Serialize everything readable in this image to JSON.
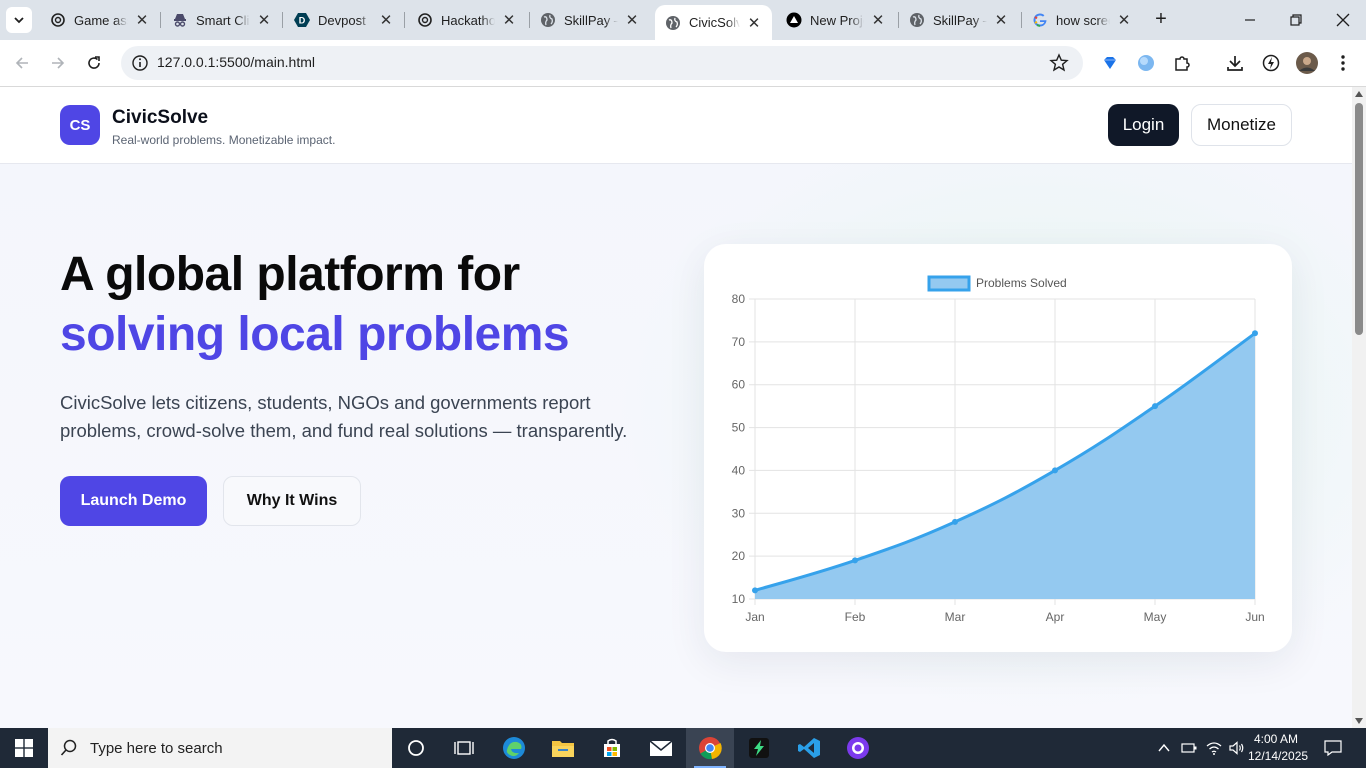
{
  "browser": {
    "tabs": [
      {
        "title": "Game assets",
        "icon": "openai-icon",
        "active": false
      },
      {
        "title": "Smart Clicker",
        "icon": "spy-icon",
        "active": false
      },
      {
        "title": "Devpost",
        "icon": "devpost-icon",
        "active": false
      },
      {
        "title": "Hackathon",
        "icon": "openai-icon",
        "active": false
      },
      {
        "title": "SkillPay –",
        "icon": "globe-icon",
        "active": false
      },
      {
        "title": "CivicSolve",
        "icon": "globe-icon",
        "active": true
      },
      {
        "title": "New Project",
        "icon": "vercel-icon",
        "active": false
      },
      {
        "title": "SkillPay –",
        "icon": "globe-icon",
        "active": false
      },
      {
        "title": "how screenshot",
        "icon": "google-icon",
        "active": false
      }
    ],
    "url": "127.0.0.1:5500/main.html"
  },
  "header": {
    "logo_text": "CS",
    "brand": "CivicSolve",
    "tagline": "Real-world problems. Monetizable impact.",
    "login_label": "Login",
    "monetize_label": "Monetize"
  },
  "hero": {
    "title_line1": "A global platform for",
    "title_line2": "solving local problems",
    "lead": "CivicSolve lets citizens, students, NGOs and governments report problems, crowd-solve them, and fund real solutions — transparently.",
    "launch_label": "Launch Demo",
    "why_label": "Why It Wins",
    "accent": "#4f46e5"
  },
  "chart_data": {
    "type": "area",
    "categories": [
      "Jan",
      "Feb",
      "Mar",
      "Apr",
      "May",
      "Jun"
    ],
    "series": [
      {
        "name": "Problems Solved",
        "values": [
          12,
          19,
          28,
          40,
          55,
          72
        ]
      }
    ],
    "ylim": [
      10,
      80
    ],
    "yticks": [
      10,
      20,
      30,
      40,
      50,
      60,
      70,
      80
    ],
    "grid": true,
    "legend": "top-center",
    "line_color": "#36a2eb",
    "fill_color": "#94c9f0"
  },
  "taskbar": {
    "search_placeholder": "Type here to search",
    "time": "4:00 AM",
    "date": "12/14/2025"
  }
}
